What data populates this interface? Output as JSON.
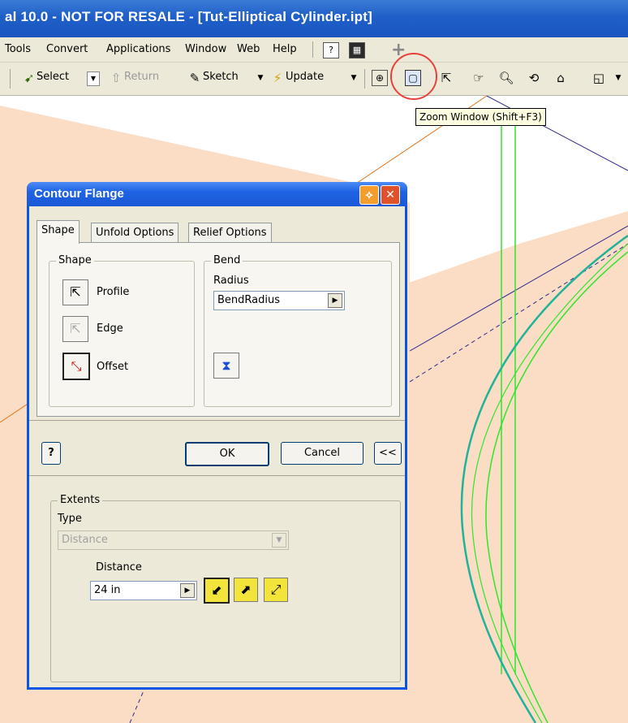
{
  "window": {
    "title": "al 10.0 - NOT FOR RESALE - [Tut-Elliptical Cylinder.ipt]"
  },
  "menu": {
    "items": [
      "Tools",
      "Convert",
      "Applications",
      "Window",
      "Web",
      "Help"
    ]
  },
  "toolbar": {
    "select_label": "Select",
    "return_label": "Return",
    "sketch_label": "Sketch",
    "update_label": "Update"
  },
  "tooltip": {
    "text": "Zoom Window (Shift+F3)"
  },
  "dialog": {
    "title": "Contour Flange",
    "tabs": [
      "Shape",
      "Unfold Options",
      "Relief Options"
    ],
    "shape_group": {
      "label": "Shape",
      "profile_label": "Profile",
      "edge_label": "Edge",
      "offset_label": "Offset"
    },
    "bend_group": {
      "label": "Bend",
      "radius_label": "Radius",
      "radius_value": "BendRadius"
    },
    "ok_label": "OK",
    "cancel_label": "Cancel",
    "collapse_label": "<<",
    "help_label": "?",
    "extents": {
      "label": "Extents",
      "type_label": "Type",
      "type_value": "Distance",
      "distance_label": "Distance",
      "distance_value": "24 in"
    }
  },
  "colors": {
    "title_blue": "#1f5fc8",
    "canvas_face": "#fbdcc4",
    "sketch_green": "#2ee62e",
    "highlight_circle": "#e8413c"
  }
}
